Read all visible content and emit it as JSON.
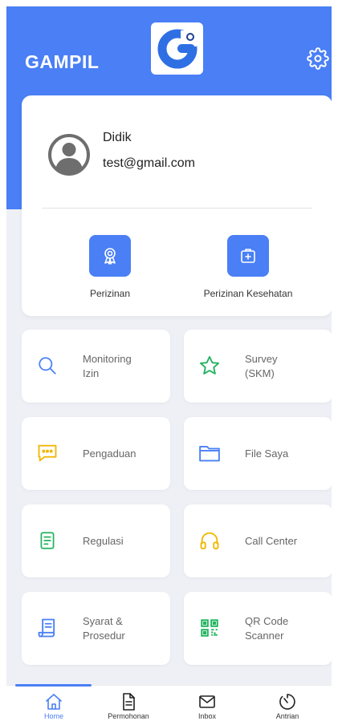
{
  "header": {
    "title": "GAMPIL",
    "logo_icon": "gampil-logo",
    "settings_icon": "gear-icon"
  },
  "profile": {
    "name": "Didik",
    "email": "test@gmail.com",
    "avatar_icon": "user-avatar-icon"
  },
  "quick_actions": [
    {
      "label": "Perizinan",
      "icon": "award-ribbon-icon"
    },
    {
      "label": "Perizinan Kesehatan",
      "icon": "medical-kit-icon"
    }
  ],
  "menu": [
    {
      "label": "Monitoring\nIzin",
      "icon": "search-icon",
      "color": "#4a7ff5"
    },
    {
      "label": "Survey\n(SKM)",
      "icon": "star-icon",
      "color": "#22b35e"
    },
    {
      "label": "Pengaduan",
      "icon": "chat-bubble-icon",
      "color": "#f2b705"
    },
    {
      "label": "File Saya",
      "icon": "folder-icon",
      "color": "#4a7ff5"
    },
    {
      "label": "Regulasi",
      "icon": "document-icon",
      "color": "#22b35e"
    },
    {
      "label": "Call Center",
      "icon": "headphones-icon",
      "color": "#f2b705"
    },
    {
      "label": "Syarat &\nProsedur",
      "icon": "scroll-document-icon",
      "color": "#4a7ff5"
    },
    {
      "label": "QR Code\nScanner",
      "icon": "qr-code-icon",
      "color": "#22b35e"
    }
  ],
  "bottom_nav": [
    {
      "label": "Home",
      "icon": "home-icon",
      "active": true
    },
    {
      "label": "Permohonan",
      "icon": "file-icon",
      "active": false
    },
    {
      "label": "Inbox",
      "icon": "mail-icon",
      "active": false
    },
    {
      "label": "Antrian",
      "icon": "timer-icon",
      "active": false
    }
  ],
  "colors": {
    "primary": "#4a7ff5",
    "background": "#eef0f6",
    "green": "#22b35e",
    "yellow": "#f2b705"
  }
}
